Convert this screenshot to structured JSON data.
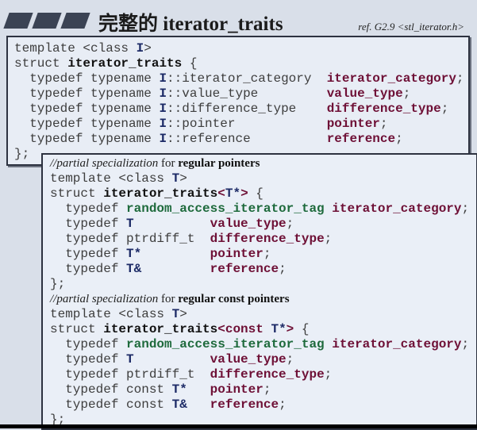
{
  "slide": {
    "title": "完整的 iterator_traits",
    "reference": "ref. G2.9  <stl_iterator.h>"
  },
  "colors": {
    "keyword_red": "#6e1036",
    "tag_green": "#1e6a3c",
    "param_blue": "#1c2a66"
  },
  "primary_template": [
    [
      [
        "n",
        "template <class "
      ],
      [
        "bb",
        "I"
      ],
      [
        "n",
        ">"
      ]
    ],
    [
      [
        "n",
        "struct "
      ],
      [
        "b",
        "iterator_traits"
      ],
      [
        "n",
        " {"
      ]
    ],
    [
      [
        "n",
        "  typedef typename "
      ],
      [
        "bb",
        "I"
      ],
      [
        "n",
        "::iterator_category  "
      ],
      [
        "r",
        "iterator_category"
      ],
      [
        "n",
        ";"
      ]
    ],
    [
      [
        "n",
        "  typedef typename "
      ],
      [
        "bb",
        "I"
      ],
      [
        "n",
        "::value_type         "
      ],
      [
        "r",
        "value_type"
      ],
      [
        "n",
        ";"
      ]
    ],
    [
      [
        "n",
        "  typedef typename "
      ],
      [
        "bb",
        "I"
      ],
      [
        "n",
        "::difference_type    "
      ],
      [
        "r",
        "difference_type"
      ],
      [
        "n",
        ";"
      ]
    ],
    [
      [
        "n",
        "  typedef typename "
      ],
      [
        "bb",
        "I"
      ],
      [
        "n",
        "::pointer            "
      ],
      [
        "r",
        "pointer"
      ],
      [
        "n",
        ";"
      ]
    ],
    [
      [
        "n",
        "  typedef typename "
      ],
      [
        "bb",
        "I"
      ],
      [
        "n",
        "::reference          "
      ],
      [
        "r",
        "reference"
      ],
      [
        "n",
        ";"
      ]
    ],
    [
      [
        "n",
        "};"
      ]
    ]
  ],
  "specializations": [
    [
      [
        "ci",
        "//partial specialization"
      ],
      [
        "cn",
        " for "
      ],
      [
        "cb",
        "regular pointers"
      ]
    ],
    [
      [
        "n",
        "template <class "
      ],
      [
        "bb",
        "T"
      ],
      [
        "n",
        ">"
      ]
    ],
    [
      [
        "n",
        "struct "
      ],
      [
        "b",
        "iterator_traits"
      ],
      [
        "r",
        "<"
      ],
      [
        "bb",
        "T*"
      ],
      [
        "r",
        ">"
      ],
      [
        "n",
        " {"
      ]
    ],
    [
      [
        "n",
        "  typedef "
      ],
      [
        "g",
        "random_access_iterator_tag"
      ],
      [
        "n",
        " "
      ],
      [
        "r",
        "iterator_category"
      ],
      [
        "n",
        ";"
      ]
    ],
    [
      [
        "n",
        "  typedef "
      ],
      [
        "bb",
        "T"
      ],
      [
        "n",
        "          "
      ],
      [
        "r",
        "value_type"
      ],
      [
        "n",
        ";"
      ]
    ],
    [
      [
        "n",
        "  typedef ptrdiff_t  "
      ],
      [
        "r",
        "difference_type"
      ],
      [
        "n",
        ";"
      ]
    ],
    [
      [
        "n",
        "  typedef "
      ],
      [
        "bb",
        "T*"
      ],
      [
        "n",
        "         "
      ],
      [
        "r",
        "pointer"
      ],
      [
        "n",
        ";"
      ]
    ],
    [
      [
        "n",
        "  typedef "
      ],
      [
        "bb",
        "T&"
      ],
      [
        "n",
        "         "
      ],
      [
        "r",
        "reference"
      ],
      [
        "n",
        ";"
      ]
    ],
    [
      [
        "n",
        "};"
      ]
    ],
    [
      [
        "ci",
        "//partial specialization"
      ],
      [
        "cn",
        " for "
      ],
      [
        "cb",
        "regular const pointers"
      ]
    ],
    [
      [
        "n",
        "template <class "
      ],
      [
        "bb",
        "T"
      ],
      [
        "n",
        ">"
      ]
    ],
    [
      [
        "n",
        "struct "
      ],
      [
        "b",
        "iterator_traits"
      ],
      [
        "r",
        "<const "
      ],
      [
        "bb",
        "T*"
      ],
      [
        "r",
        ">"
      ],
      [
        "n",
        " {"
      ]
    ],
    [
      [
        "n",
        "  typedef "
      ],
      [
        "g",
        "random_access_iterator_tag"
      ],
      [
        "n",
        " "
      ],
      [
        "r",
        "iterator_category"
      ],
      [
        "n",
        ";"
      ]
    ],
    [
      [
        "n",
        "  typedef "
      ],
      [
        "bb",
        "T"
      ],
      [
        "n",
        "          "
      ],
      [
        "r",
        "value_type"
      ],
      [
        "n",
        ";"
      ]
    ],
    [
      [
        "n",
        "  typedef ptrdiff_t  "
      ],
      [
        "r",
        "difference_type"
      ],
      [
        "n",
        ";"
      ]
    ],
    [
      [
        "n",
        "  typedef const "
      ],
      [
        "bb",
        "T*"
      ],
      [
        "n",
        "   "
      ],
      [
        "r",
        "pointer"
      ],
      [
        "n",
        ";"
      ]
    ],
    [
      [
        "n",
        "  typedef const "
      ],
      [
        "bb",
        "T&"
      ],
      [
        "n",
        "   "
      ],
      [
        "r",
        "reference"
      ],
      [
        "n",
        ";"
      ]
    ],
    [
      [
        "n",
        "};"
      ]
    ]
  ]
}
